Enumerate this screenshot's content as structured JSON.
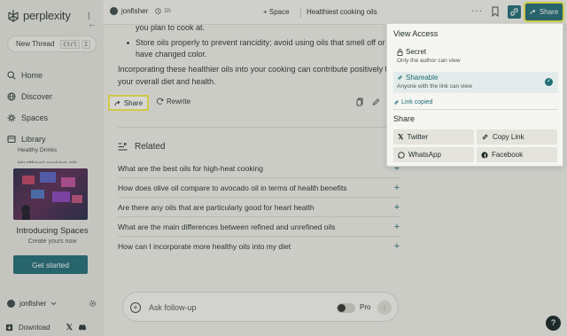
{
  "app": {
    "name": "perplexity"
  },
  "sidebar": {
    "new_thread": "New Thread",
    "shortcut": [
      "Ctrl",
      "I"
    ],
    "nav": [
      {
        "label": "Home",
        "icon": "search-icon"
      },
      {
        "label": "Discover",
        "icon": "globe-icon"
      },
      {
        "label": "Spaces",
        "icon": "spaces-icon"
      },
      {
        "label": "Library",
        "icon": "library-icon"
      }
    ],
    "library_items": [
      "Healthy Drinks",
      "Healthiest cooking oils"
    ],
    "promo": {
      "title": "Introducing Spaces",
      "subtitle": "Create yours now",
      "button": "Get started"
    },
    "user": "jonfisher",
    "download": "Download"
  },
  "topbar": {
    "user": "jonfisher",
    "time": "1h",
    "space": "+ Space",
    "title": "Healthiest cooking oils",
    "share": "Share"
  },
  "answer": {
    "line1": "you plan to cook at.",
    "bullet": "Store oils properly to prevent rancidity; avoid using oils that smell off or",
    "line3": "have changed color.",
    "para1": "Incorporating these healthier oils into your cooking can contribute positively to",
    "para2": "your overall diet and health."
  },
  "actions": {
    "share": "Share",
    "rewrite": "Rewrite"
  },
  "related": {
    "heading": "Related",
    "items": [
      "What are the best oils for high-heat cooking",
      "How does olive oil compare to avocado oil in terms of health benefits",
      "Are there any oils that are particularly good for heart health",
      "What are the main differences between refined and unrefined oils",
      "How can I incorporate more healthy oils into my diet"
    ]
  },
  "followup": {
    "placeholder": "Ask follow-up",
    "pro": "Pro"
  },
  "help": "?",
  "share_panel": {
    "view_access": "View Access",
    "options": [
      {
        "title": "Secret",
        "desc": "Only the author can view",
        "selected": false
      },
      {
        "title": "Shareable",
        "desc": "Anyone with the link can view",
        "selected": true
      }
    ],
    "link_copied": "Link copied",
    "share_heading": "Share",
    "buttons": [
      "Twitter",
      "Copy Link",
      "WhatsApp",
      "Facebook"
    ]
  },
  "colors": {
    "accent": "#1f6e78",
    "highlight": "#f7ef4a",
    "background": "#f3f3ee"
  }
}
